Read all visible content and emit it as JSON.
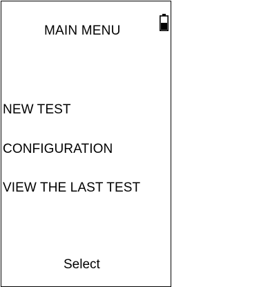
{
  "menu": {
    "title": "MAIN MENU",
    "items": [
      {
        "label": "NEW TEST"
      },
      {
        "label": "CONFIGURATION"
      },
      {
        "label": "VIEW THE LAST TEST"
      }
    ]
  },
  "softkey": {
    "label": "Select"
  },
  "status": {
    "battery_icon": "battery-icon"
  },
  "colors": {
    "text": "#000000",
    "background": "#ffffff",
    "border": "#000000"
  }
}
